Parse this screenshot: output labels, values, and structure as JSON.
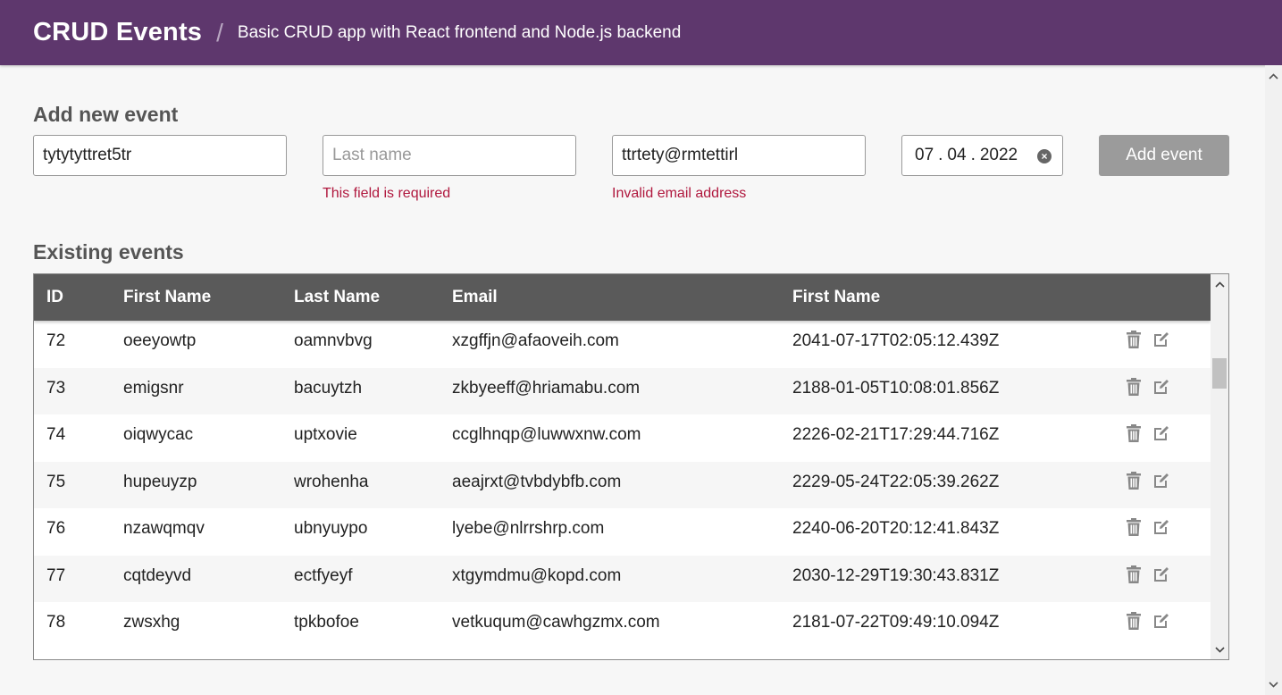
{
  "header": {
    "title": "CRUD Events",
    "separator": "/",
    "subtitle": "Basic CRUD app with React frontend and Node.js backend"
  },
  "form": {
    "heading": "Add new event",
    "first_name_value": "tytytyttret5tr",
    "last_name_value": "",
    "last_name_placeholder": "Last name",
    "last_name_error": "This field is required",
    "email_value": "ttrtety@rmtettirl",
    "email_error": "Invalid email address",
    "date": {
      "day": "07",
      "month": "04",
      "year": "2022"
    },
    "submit_label": "Add event"
  },
  "events": {
    "heading": "Existing events",
    "columns": [
      "ID",
      "First Name",
      "Last Name",
      "Email",
      "First Name"
    ],
    "rows": [
      {
        "id": "72",
        "first": "oeeyowtp",
        "last": "oamnvbvg",
        "email": "xzgffjn@afaoveih.com",
        "date": "2041-07-17T02:05:12.439Z"
      },
      {
        "id": "73",
        "first": "emigsnr",
        "last": "bacuytzh",
        "email": "zkbyeeff@hriamabu.com",
        "date": "2188-01-05T10:08:01.856Z"
      },
      {
        "id": "74",
        "first": "oiqwycac",
        "last": "uptxovie",
        "email": "ccglhnqp@luwwxnw.com",
        "date": "2226-02-21T17:29:44.716Z"
      },
      {
        "id": "75",
        "first": "hupeuyzp",
        "last": "wrohenha",
        "email": "aeajrxt@tvbdybfb.com",
        "date": "2229-05-24T22:05:39.262Z"
      },
      {
        "id": "76",
        "first": "nzawqmqv",
        "last": "ubnyuypo",
        "email": "lyebe@nlrrshrp.com",
        "date": "2240-06-20T20:12:41.843Z"
      },
      {
        "id": "77",
        "first": "cqtdeyvd",
        "last": "ectfyeyf",
        "email": "xtgymdmu@kopd.com",
        "date": "2030-12-29T19:30:43.831Z"
      },
      {
        "id": "78",
        "first": "zwsxhg",
        "last": "tpkbofoe",
        "email": "vetkuqum@cawhgzmx.com",
        "date": "2181-07-22T09:49:10.094Z"
      }
    ]
  },
  "icons": {
    "delete": "trash-icon",
    "edit": "edit-icon"
  },
  "colors": {
    "topbar": "#5e376d",
    "table_header": "#5a5a5a",
    "error": "#b0183e",
    "button_disabled": "#9b9b9b"
  }
}
